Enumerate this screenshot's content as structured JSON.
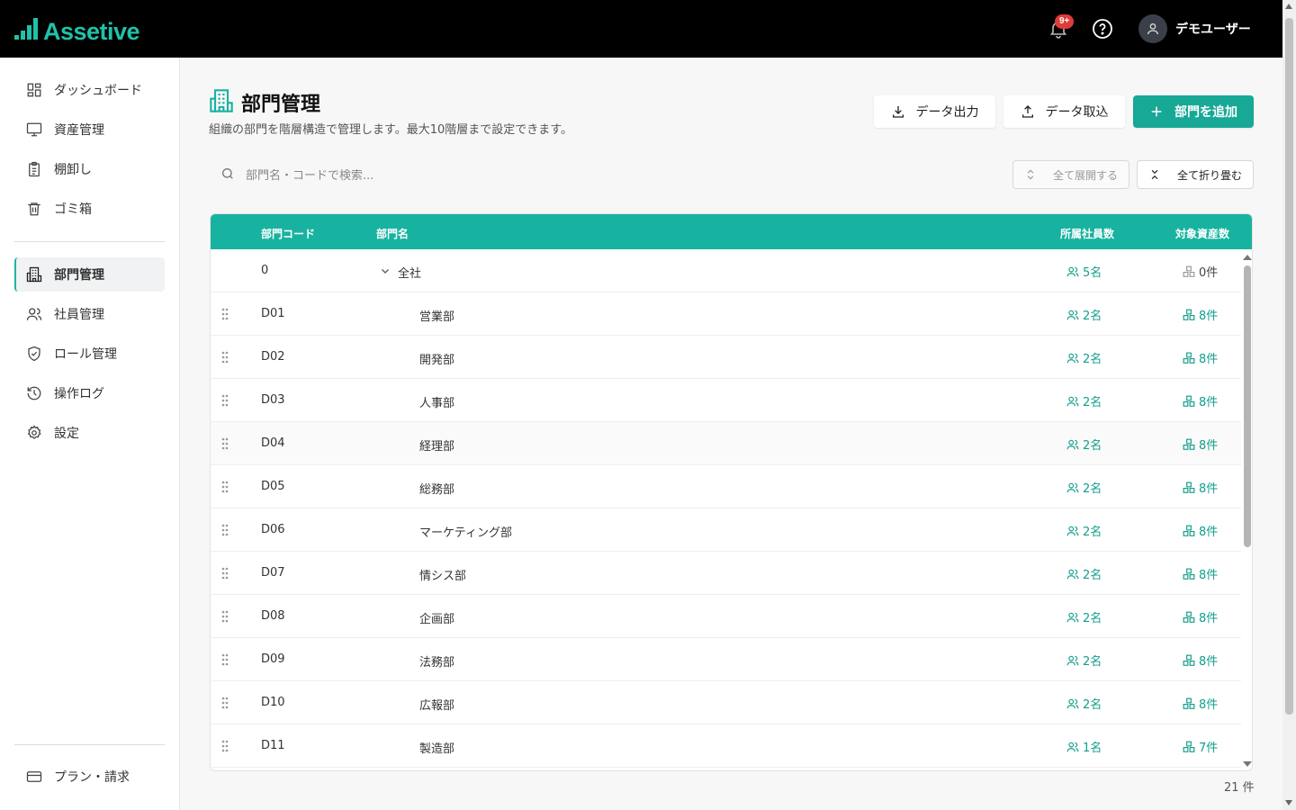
{
  "header": {
    "logo_text": "Assetive",
    "notification_badge": "9+",
    "user_name": "デモユーザー"
  },
  "sidebar": {
    "items": [
      {
        "label": "ダッシュボード",
        "icon": "dashboard-icon"
      },
      {
        "label": "資産管理",
        "icon": "monitor-icon"
      },
      {
        "label": "棚卸し",
        "icon": "clipboard-icon"
      },
      {
        "label": "ゴミ箱",
        "icon": "trash-icon"
      },
      {
        "label": "部門管理",
        "icon": "building-icon",
        "active": true
      },
      {
        "label": "社員管理",
        "icon": "users-icon"
      },
      {
        "label": "ロール管理",
        "icon": "shield-icon"
      },
      {
        "label": "操作ログ",
        "icon": "history-icon"
      },
      {
        "label": "設定",
        "icon": "gear-icon"
      }
    ],
    "footer_item": {
      "label": "プラン・請求",
      "icon": "credit-card-icon"
    }
  },
  "page": {
    "title": "部門管理",
    "subtitle": "組織の部門を階層構造で管理します。最大10階層まで設定できます。",
    "export_label": "データ出力",
    "import_label": "データ取込",
    "add_label": "部門を追加",
    "search_placeholder": "部門名・コードで検索...",
    "expand_all_label": "全て展開する",
    "collapse_all_label": "全て折り畳む",
    "total_count": "21 件"
  },
  "table": {
    "columns": {
      "code": "部門コード",
      "name": "部門名",
      "employees": "所属社員数",
      "assets": "対象資産数"
    },
    "rows": [
      {
        "code": "0",
        "name": "全社",
        "employees": "5名",
        "assets": "0件",
        "root": true
      },
      {
        "code": "D01",
        "name": "営業部",
        "employees": "2名",
        "assets": "8件"
      },
      {
        "code": "D02",
        "name": "開発部",
        "employees": "2名",
        "assets": "8件"
      },
      {
        "code": "D03",
        "name": "人事部",
        "employees": "2名",
        "assets": "8件"
      },
      {
        "code": "D04",
        "name": "経理部",
        "employees": "2名",
        "assets": "8件",
        "hover": true
      },
      {
        "code": "D05",
        "name": "総務部",
        "employees": "2名",
        "assets": "8件"
      },
      {
        "code": "D06",
        "name": "マーケティング部",
        "employees": "2名",
        "assets": "8件"
      },
      {
        "code": "D07",
        "name": "情シス部",
        "employees": "2名",
        "assets": "8件"
      },
      {
        "code": "D08",
        "name": "企画部",
        "employees": "2名",
        "assets": "8件"
      },
      {
        "code": "D09",
        "name": "法務部",
        "employees": "2名",
        "assets": "8件"
      },
      {
        "code": "D10",
        "name": "広報部",
        "employees": "2名",
        "assets": "8件"
      },
      {
        "code": "D11",
        "name": "製造部",
        "employees": "1名",
        "assets": "7件"
      }
    ]
  },
  "colors": {
    "accent": "#18b3a0",
    "accent_text": "#129e8b",
    "header_bg": "#000000",
    "badge": "#e03b3b"
  }
}
